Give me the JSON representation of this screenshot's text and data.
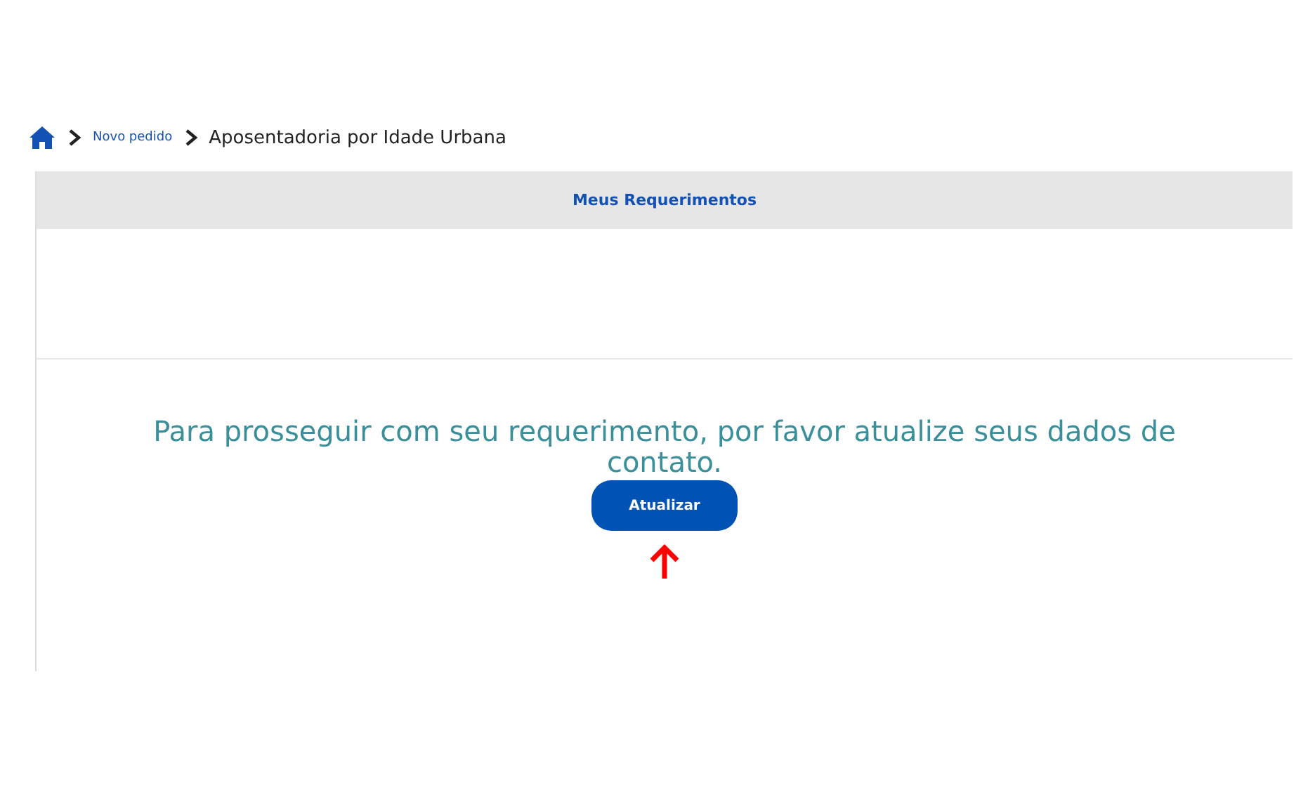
{
  "breadcrumb": [
    {
      "label": "Novo pedido",
      "kind": "link"
    },
    {
      "label": "Aposentadoria por Idade Urbana",
      "kind": "current"
    }
  ],
  "panel": {
    "tab": "Meus Requerimentos",
    "message": "Para prosseguir com seu requerimento, por favor atualize seus dados de contato.",
    "button": "Atualizar"
  }
}
